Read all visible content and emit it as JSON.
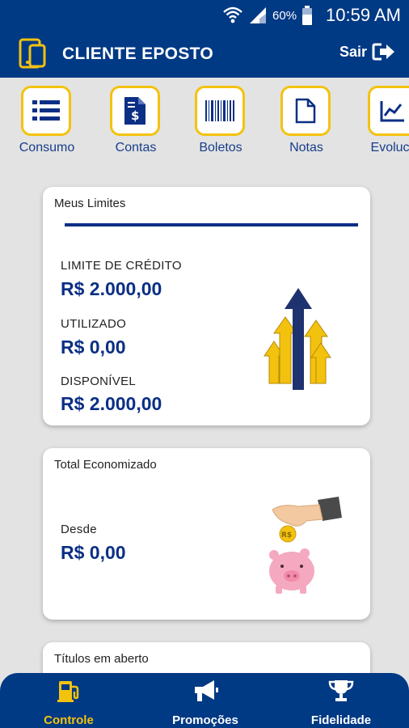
{
  "status_bar": {
    "battery": "60%",
    "time": "10:59 AM"
  },
  "app_bar": {
    "title": "CLIENTE EPOSTO",
    "logout_label": "Sair"
  },
  "shortcuts": [
    {
      "label": "Consumo",
      "icon": "list-icon"
    },
    {
      "label": "Contas",
      "icon": "invoice-dollar-icon"
    },
    {
      "label": "Boletos",
      "icon": "barcode-icon"
    },
    {
      "label": "Notas",
      "icon": "document-icon"
    },
    {
      "label": "Evoluca",
      "icon": "line-chart-icon"
    }
  ],
  "limits_card": {
    "title": "Meus Limites",
    "credit_limit_label": "LIMITE DE CRÉDITO",
    "credit_limit_value": "R$ 2.000,00",
    "used_label": "UTILIZADO",
    "used_value": "R$ 0,00",
    "available_label": "DISPONÍVEL",
    "available_value": "R$ 2.000,00"
  },
  "savings_card": {
    "title": "Total Economizado",
    "since_label": "Desde",
    "value": "R$ 0,00",
    "coin_text": "R$"
  },
  "open_titles_card": {
    "title": "Títulos em aberto"
  },
  "bottom_nav": [
    {
      "label": "Controle",
      "icon": "fuel-pump-icon",
      "active": true
    },
    {
      "label": "Promoções",
      "icon": "megaphone-icon",
      "active": false
    },
    {
      "label": "Fidelidade",
      "icon": "trophy-icon",
      "active": false
    }
  ],
  "colors": {
    "primary": "#003984",
    "accent": "#f3c20f",
    "amount": "#0b2f85"
  }
}
